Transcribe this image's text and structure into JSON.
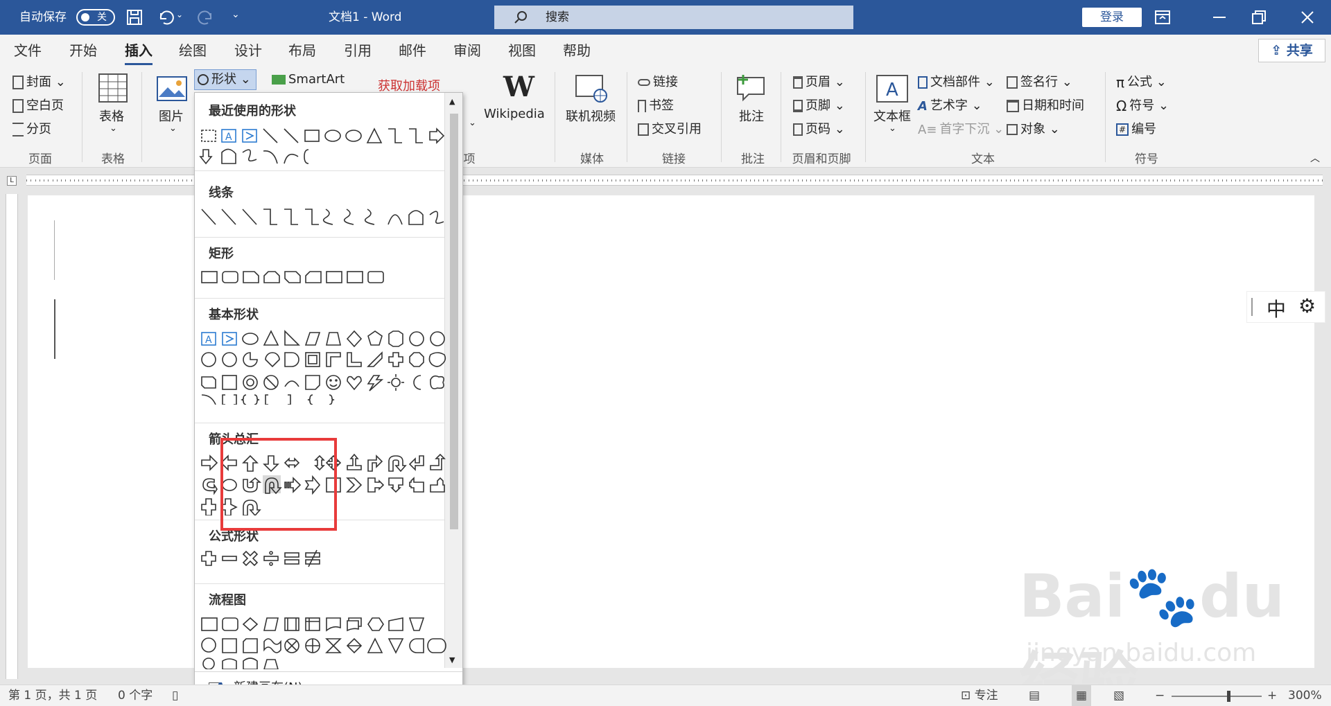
{
  "titlebar": {
    "autosave": "自动保存",
    "toggle": "关",
    "doc_title": "文档1  -  Word",
    "search_placeholder": "搜索",
    "login": "登录"
  },
  "menu": [
    "文件",
    "开始",
    "插入",
    "绘图",
    "设计",
    "布局",
    "引用",
    "邮件",
    "审阅",
    "视图",
    "帮助"
  ],
  "share": "共享",
  "ribbon": {
    "page_group": {
      "items": [
        "封面",
        "空白页",
        "分页"
      ],
      "label": "页面"
    },
    "table_group": {
      "item": "表格",
      "label": "表格"
    },
    "illus": {
      "picture": "图片",
      "shapes": "形状",
      "smartart": "SmartArt",
      "addins": "获取加载项",
      "wikipedia": "Wikipedia",
      "addins_label": "项"
    },
    "media": {
      "item": "联机视频",
      "label": "媒体"
    },
    "links": {
      "items": [
        "链接",
        "书签",
        "交叉引用"
      ],
      "label": "链接"
    },
    "comment": {
      "item": "批注",
      "label": "批注"
    },
    "header_footer": {
      "items": [
        "页眉",
        "页脚",
        "页码"
      ],
      "label": "页眉和页脚"
    },
    "text": {
      "textbox": "文本框",
      "parts": "文档部件",
      "wordart": "艺术字",
      "dropcap": "首字下沉",
      "signature": "签名行",
      "datetime": "日期和时间",
      "object": "对象",
      "label": "文本"
    },
    "symbols": {
      "items": [
        "公式",
        "符号",
        "编号"
      ],
      "label": "符号"
    }
  },
  "dropdown": {
    "sections": [
      "最近使用的形状",
      "线条",
      "矩形",
      "基本形状",
      "箭头总汇",
      "公式形状",
      "流程图"
    ],
    "new_canvas": "新建画布(N)"
  },
  "status": {
    "page": "第 1 页，共 1 页",
    "words": "0 个字",
    "focus": "专注",
    "zoom": "300%"
  },
  "ime": {
    "label": "中"
  },
  "watermark": {
    "brand": "Bai",
    "brand2": "du",
    "cn": "经验",
    "url": "jingyan.baidu.com"
  }
}
